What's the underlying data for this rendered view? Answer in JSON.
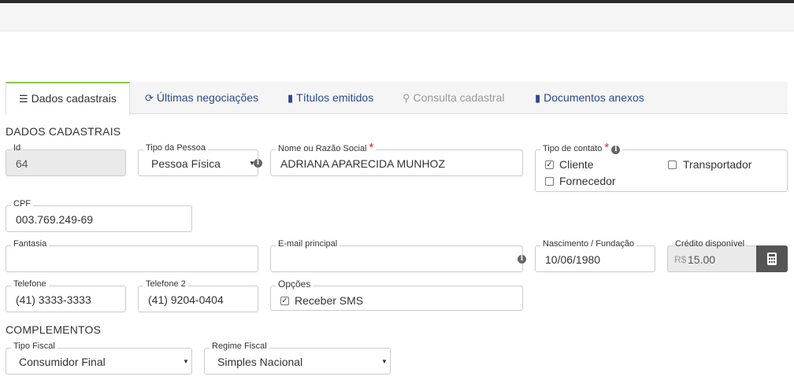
{
  "tabs": [
    {
      "label": "Dados cadastrais",
      "icon": "list-icon"
    },
    {
      "label": "Últimas negociações",
      "icon": "refresh-icon"
    },
    {
      "label": "Títulos emitidos",
      "icon": "file-icon"
    },
    {
      "label": "Consulta cadastral",
      "icon": "search-icon"
    },
    {
      "label": "Documentos anexos",
      "icon": "file-icon"
    }
  ],
  "sections": {
    "dados": "DADOS CADASTRAIS",
    "complementos": "COMPLEMENTOS"
  },
  "fields": {
    "id": {
      "label": "Id",
      "value": "64"
    },
    "tipo_pessoa": {
      "label": "Tipo da Pessoa",
      "value": "Pessoa Física"
    },
    "nome": {
      "label": "Nome ou Razão Social",
      "value": "ADRIANA APARECIDA MUNHOZ"
    },
    "tipo_contato": {
      "label": "Tipo de contato",
      "options": [
        {
          "label": "Cliente",
          "checked": true
        },
        {
          "label": "Transportador",
          "checked": false
        },
        {
          "label": "Fornecedor",
          "checked": false
        }
      ]
    },
    "cpf": {
      "label": "CPF",
      "value": "003.769.249-69"
    },
    "fantasia": {
      "label": "Fantasia",
      "value": ""
    },
    "email": {
      "label": "E-mail principal",
      "value": ""
    },
    "nascimento": {
      "label": "Nascimento / Fundação",
      "value": "10/06/1980"
    },
    "credito": {
      "label": "Crédito disponível",
      "prefix": "R$",
      "value": "15.00"
    },
    "telefone": {
      "label": "Telefone",
      "value": "(41) 3333-3333"
    },
    "telefone2": {
      "label": "Telefone 2",
      "value": "(41) 9204-0404"
    },
    "opcoes": {
      "label": "Opções",
      "options": [
        {
          "label": "Receber SMS",
          "checked": true
        }
      ]
    },
    "tipo_fiscal": {
      "label": "Tipo Fiscal",
      "value": "Consumidor Final"
    },
    "regime_fiscal": {
      "label": "Regime Fiscal",
      "value": "Simples Nacional"
    }
  },
  "colors": {
    "tab_link": "#2b4a8b",
    "active_tab_accent": "#8bc34a",
    "required": "#e02020"
  }
}
